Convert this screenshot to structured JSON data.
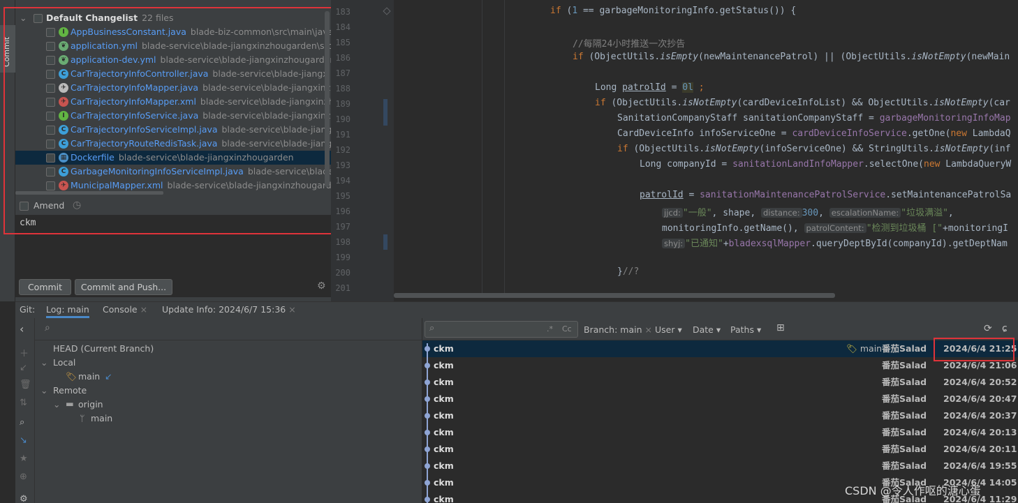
{
  "sidebar": {
    "commit_tab": "Commit"
  },
  "changelist": {
    "name": "Default Changelist",
    "count": "22 files",
    "files": [
      {
        "name": "AppBusinessConstant.java",
        "path": "blade-biz-common\\src\\main\\java\\org",
        "icon": "interface-icon",
        "color": "#62b543",
        "letter": "I"
      },
      {
        "name": "application.yml",
        "path": "blade-service\\blade-jiangxinzhougarden\\src\\ma",
        "icon": "yaml-leaf-icon",
        "color": "#6aab73",
        "letter": "❦"
      },
      {
        "name": "application-dev.yml",
        "path": "blade-service\\blade-jiangxinzhougarden\\sr",
        "icon": "yaml-leaf-icon",
        "color": "#6aab73",
        "letter": "❦"
      },
      {
        "name": "CarTrajectoryInfoController.java",
        "path": "blade-service\\blade-jiangxinzho",
        "icon": "class-icon",
        "color": "#3d9fd8",
        "letter": "C"
      },
      {
        "name": "CarTrajectoryInfoMapper.java",
        "path": "blade-service\\blade-jiangxinzhou",
        "icon": "mybatis-bird-icon",
        "color": "#bbbbbb",
        "letter": "✈"
      },
      {
        "name": "CarTrajectoryInfoMapper.xml",
        "path": "blade-service\\blade-jiangxinzhoug",
        "icon": "mybatis-xml-icon",
        "color": "#c75450",
        "letter": "✈"
      },
      {
        "name": "CarTrajectoryInfoService.java",
        "path": "blade-service\\blade-jiangxinzhoug",
        "icon": "interface-icon",
        "color": "#62b543",
        "letter": "I"
      },
      {
        "name": "CarTrajectoryInfoServiceImpl.java",
        "path": "blade-service\\blade-jiangxinzh",
        "icon": "class-icon",
        "color": "#3d9fd8",
        "letter": "C"
      },
      {
        "name": "CarTrajectoryRouteRedisTask.java",
        "path": "blade-service\\blade-jiangxinzh",
        "icon": "class-icon",
        "color": "#3d9fd8",
        "letter": "C"
      },
      {
        "name": "Dockerfile",
        "path": "blade-service\\blade-jiangxinzhougarden",
        "icon": "docker-icon",
        "color": "#4a90c8",
        "letter": "▦"
      },
      {
        "name": "GarbageMonitoringInfoServiceImpl.java",
        "path": "blade-service\\blade-jia",
        "icon": "class-icon",
        "color": "#3d9fd8",
        "letter": "C"
      },
      {
        "name": "MunicipalMapper.xml",
        "path": "blade-service\\blade-jiangxinzhougarden\\",
        "icon": "mybatis-xml-icon",
        "color": "#c75450",
        "letter": "✈"
      }
    ],
    "amend_label": "Amend",
    "commit_message": "ckm",
    "commit_button": "Commit",
    "commit_push_button": "Commit and Push..."
  },
  "editor": {
    "line_numbers": [
      "183",
      "184",
      "185",
      "186",
      "187",
      "188",
      "189",
      "190",
      "191",
      "192",
      "193",
      "194",
      "195",
      "196",
      "197",
      "198",
      "199",
      "200",
      "201"
    ],
    "hints": {
      "jjcd": "jjcd:",
      "distance": "distance:",
      "escalation": "escalationName:",
      "patrol_content": "patrolContent:",
      "shyj": "shyj:"
    }
  },
  "bottom_tabs": {
    "git": "Git:",
    "log": "Log: main",
    "console": "Console",
    "update_info": "Update Info: 2024/6/7 15:36"
  },
  "branches": {
    "head": "HEAD (Current Branch)",
    "local": "Local",
    "local_main": "main",
    "remote": "Remote",
    "origin": "origin",
    "origin_main": "main"
  },
  "log_filters": {
    "branch": "Branch: main",
    "user": "User",
    "date": "Date",
    "paths": "Paths",
    "regex_toggle": ".*",
    "case_toggle": "Cc"
  },
  "commits": [
    {
      "message": "ckm",
      "author": "番茄Salad",
      "date": "2024/6/4 21:25",
      "branch": "main",
      "selected": true
    },
    {
      "message": "ckm",
      "author": "番茄Salad",
      "date": "2024/6/4 21:06"
    },
    {
      "message": "ckm",
      "author": "番茄Salad",
      "date": "2024/6/4 20:52"
    },
    {
      "message": "ckm",
      "author": "番茄Salad",
      "date": "2024/6/4 20:47"
    },
    {
      "message": "ckm",
      "author": "番茄Salad",
      "date": "2024/6/4 20:37"
    },
    {
      "message": "ckm",
      "author": "番茄Salad",
      "date": "2024/6/4 20:13"
    },
    {
      "message": "ckm",
      "author": "番茄Salad",
      "date": "2024/6/4 20:11"
    },
    {
      "message": "ckm",
      "author": "番茄Salad",
      "date": "2024/6/4 19:55"
    },
    {
      "message": "ckm",
      "author": "番茄Salad",
      "date": "2024/6/4 14:05"
    },
    {
      "message": "ckm",
      "author": "番茄Salad",
      "date": "2024/6/4 11:29"
    }
  ],
  "watermark": "CSDN @令人作呕的溏心蛋",
  "colors": {
    "accent": "#4a88c7",
    "highlight_box": "#e0333a",
    "selection": "#0d293e"
  }
}
